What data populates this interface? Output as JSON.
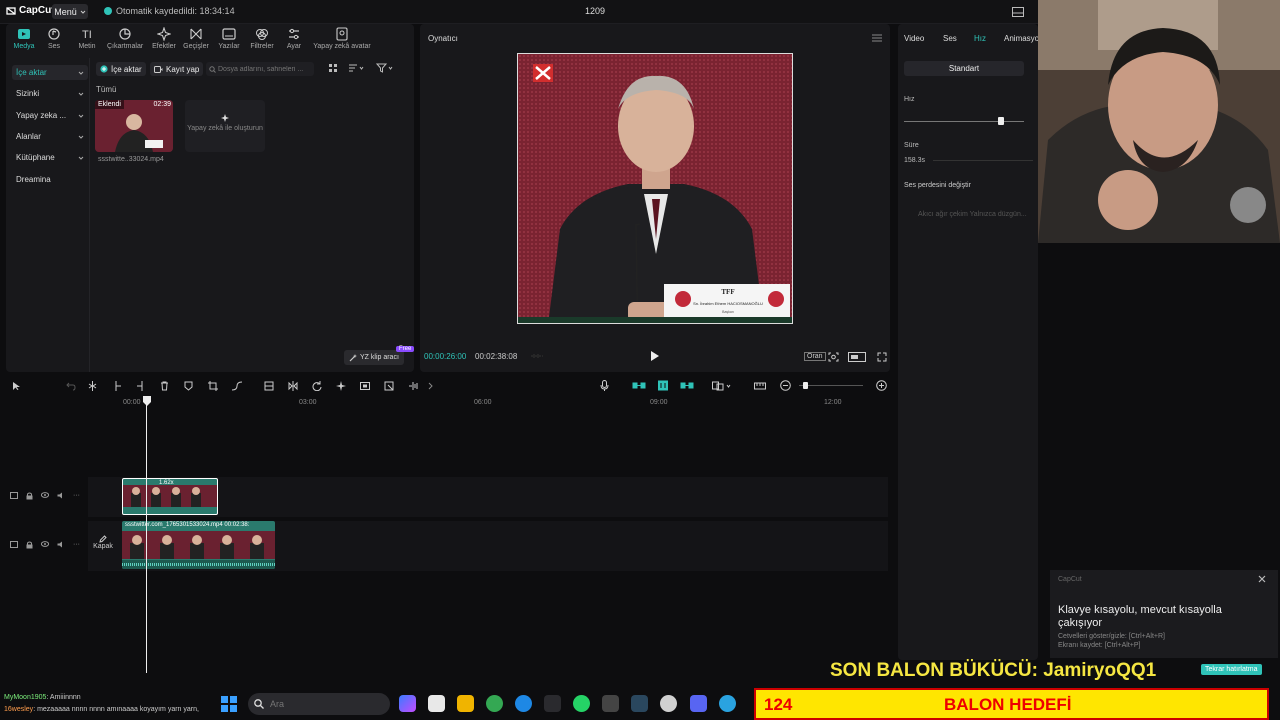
{
  "titlebar": {
    "app_name": "CapCut",
    "menu_label": "Menü",
    "autosave_text": "Otomatik kaydedildi: 18:34:14",
    "project_name": "1209"
  },
  "toolbar": {
    "tools": [
      {
        "label": "Medya",
        "icon": "media-icon"
      },
      {
        "label": "Ses",
        "icon": "audio-icon"
      },
      {
        "label": "Metin",
        "icon": "text-icon"
      },
      {
        "label": "Çıkartmalar",
        "icon": "sticker-icon"
      },
      {
        "label": "Efektler",
        "icon": "effects-icon"
      },
      {
        "label": "Geçişler",
        "icon": "transition-icon"
      },
      {
        "label": "Yazılar",
        "icon": "captions-icon"
      },
      {
        "label": "Filtreler",
        "icon": "filter-icon"
      },
      {
        "label": "Ayar",
        "icon": "adjust-icon"
      },
      {
        "label": "Yapay zekâ avatar",
        "icon": "avatar-icon"
      }
    ]
  },
  "sidebar": {
    "items": [
      {
        "label": "İçe aktar",
        "active": true
      },
      {
        "label": "Sizinki"
      },
      {
        "label": "Yapay zeka ..."
      },
      {
        "label": "Alanlar"
      },
      {
        "label": "Kütüphane"
      },
      {
        "label": "Dreamina"
      }
    ]
  },
  "media": {
    "import_label": "İçe aktar",
    "record_label": "Kayıt yap",
    "search_placeholder": "Dosya adlarını, sahneleri ...",
    "filter_all": "Tümü",
    "card_added": "Eklendi",
    "card_duration": "02:39",
    "card_name": "ssstwitte..33024.mp4",
    "ai_card_text": "Yapay zekâ ile oluşturun",
    "yz_clip_label": "YZ klip aracı",
    "free_badge": "Free"
  },
  "player": {
    "title": "Oynatıcı",
    "timecode_current": "00:00:26:00",
    "timecode_total": "00:02:38:08",
    "nameplate_org": "TFF",
    "nameplate_name": "Sn. İbrahim Ethem HACIOSMANOĞLU",
    "nameplate_role": "Başkan",
    "ratio_label": "Oran"
  },
  "inspector": {
    "tabs": [
      "Video",
      "Ses",
      "Hız",
      "Animasyon"
    ],
    "active_tab": "Hız",
    "standard_btn": "Standart",
    "speed_label": "Hız",
    "speed_level": 0.81,
    "duration_label": "Süre",
    "duration_value": "158.3s",
    "pitch_label": "Ses perdesini değiştir",
    "smooth_label": "Akıcı ağır çekim  Yalnızca düzgün..."
  },
  "timeline": {
    "ruler": [
      "00:00",
      "03:00",
      "06:00",
      "09:00",
      "12:00"
    ],
    "clip_speed_label": "1.62x",
    "clip_main_name": "ssstwitter.com_1765301533024.mp4",
    "clip_main_duration": "00:02:38:",
    "cover_label": "Kapak"
  },
  "notification": {
    "app": "CapCut",
    "title": "Klavye kısayolu, mevcut kısayolla çakışıyor",
    "line1": "Cetvelleri göster/gizle: [Ctrl+Alt+R]",
    "line2": "Ekranı kaydet: [Ctrl+Alt+P]"
  },
  "overlay": {
    "balon_text": "SON BALON BÜKÜCÜ: JamiryoQQ1",
    "remind_label": "Tekrar hatırlatma",
    "goal_count": "124",
    "goal_text": "BALON HEDEFİ",
    "chat": [
      {
        "user": "MyMoon1905",
        "msg": ": Amiiinnnn"
      },
      {
        "user": "16wesley",
        "msg": ": mezaaaaa nnnn nnnn amınaaaa koyayım yarn yarn,"
      }
    ]
  },
  "taskbar": {
    "search_placeholder": "Ara"
  },
  "colors": {
    "accent": "#2fc3b8",
    "clip": "#2a7a6d",
    "goal_bg": "#ffe600",
    "goal_text": "#e00000",
    "balon_text": "#f5e642"
  }
}
